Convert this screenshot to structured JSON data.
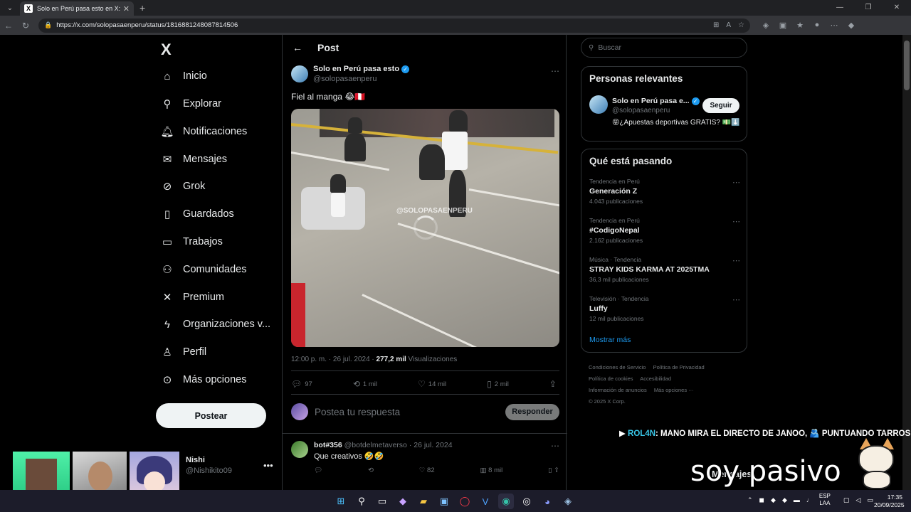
{
  "browser": {
    "tab_title": "Solo en Perú pasa esto en X: \"Fiel",
    "url": "https://x.com/solopasaenperu/status/1816881248087814506"
  },
  "sidebar": {
    "logo": "X",
    "items": [
      {
        "label": "Inicio",
        "icon": "home-icon"
      },
      {
        "label": "Explorar",
        "icon": "search-icon"
      },
      {
        "label": "Notificaciones",
        "icon": "bell-icon"
      },
      {
        "label": "Mensajes",
        "icon": "mail-icon"
      },
      {
        "label": "Grok",
        "icon": "grok-icon"
      },
      {
        "label": "Guardados",
        "icon": "bookmark-icon"
      },
      {
        "label": "Trabajos",
        "icon": "briefcase-icon"
      },
      {
        "label": "Comunidades",
        "icon": "people-icon"
      },
      {
        "label": "Premium",
        "icon": "x-icon"
      },
      {
        "label": "Organizaciones v...",
        "icon": "lightning-icon"
      },
      {
        "label": "Perfil",
        "icon": "person-icon"
      },
      {
        "label": "Más opciones",
        "icon": "more-circle-icon"
      }
    ],
    "post_button": "Postear",
    "me": {
      "name": "Nishi",
      "handle": "@Nishikito09"
    }
  },
  "main": {
    "title": "Post",
    "author": {
      "name": "Solo en Perú pasa esto",
      "handle": "@solopasaenperu"
    },
    "text": "Fiel al manga 😂🇵🇪",
    "watermark": "@SOLOPASAENPERU",
    "time": "12:00 p. m. · 26 jul. 2024 · ",
    "views_count": "277,2 mil",
    "views_label": " Visualizaciones",
    "stats": {
      "replies": "97",
      "reposts": "1 mil",
      "likes": "14 mil",
      "bookmarks": "2 mil"
    },
    "reply_placeholder": "Postea tu respuesta",
    "reply_button": "Responder",
    "first_reply": {
      "name": "bot#356",
      "handle": "@botdelmetaverso",
      "date": " · 26 jul. 2024",
      "text": "Que creativos 🤣🤣",
      "likes": "82",
      "views": "8 mil"
    }
  },
  "right": {
    "search_placeholder": "Buscar",
    "relevant_title": "Personas relevantes",
    "relevant": {
      "name": "Solo en Perú pasa e...",
      "handle": "@solopasaenperu",
      "bio": "😝¿Apuestas deportivas GRATIS? 💵⬇️",
      "follow": "Seguir"
    },
    "trends_title": "Qué está pasando",
    "trends": [
      {
        "context": "Tendencia en Perú",
        "name": "Generación Z",
        "posts": "4.043 publicaciones"
      },
      {
        "context": "Tendencia en Perú",
        "name": "#CodigoNepal",
        "posts": "2.162 publicaciones"
      },
      {
        "context": "Música · Tendencia",
        "name": "STRAY KIDS KARMA AT 2025TMA",
        "posts": "36,3 mil publicaciones"
      },
      {
        "context": "Televisión · Tendencia",
        "name": "Luffy",
        "posts": "12 mil publicaciones"
      }
    ],
    "show_more": "Mostrar más",
    "footer": [
      "Condiciones de Servicio",
      "Política de Privacidad",
      "Política de cookies",
      "Accesibilidad",
      "Información de anuncios",
      "Más opciones ···",
      "© 2025 X Corp."
    ]
  },
  "overlay": {
    "ticker_name": "ROL4N",
    "ticker_text": ": MANO MIRA EL DIRECTO DE JANOO, 🫂 PUNTUANDO TARROS",
    "big_text": "soy pasivo",
    "messages_label": "Mensajes"
  },
  "taskbar": {
    "lang_top": "ESP",
    "lang_bottom": "LAA",
    "time": "17:35",
    "date": "20/09/2025"
  }
}
